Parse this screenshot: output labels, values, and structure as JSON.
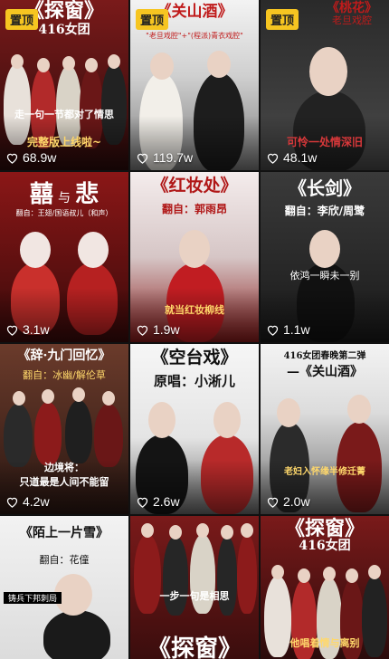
{
  "pin_label": "置顶",
  "tiles": [
    {
      "title": "《探窗》",
      "subtitle": "416女团",
      "caption1": "走一句一节都对了情思",
      "caption2": "完整版上线啦~",
      "likes": "68.9w",
      "pinned": true
    },
    {
      "title": "《关山酒》",
      "subtitle": "\"老旦戏腔\"+\"(程派)青衣戏腔\"",
      "likes": "119.7w",
      "pinned": true
    },
    {
      "title": "《桃花》",
      "subtitle": "老旦戏腔",
      "caption1": "可怜一处情深旧",
      "likes": "48.1w",
      "pinned": true
    },
    {
      "title": "囍",
      "title2": "与",
      "title3": "悲",
      "subtitle": "翻自：王翅/国语叔儿（和声）",
      "likes": "3.1w"
    },
    {
      "title": "《红妆处》",
      "subtitle": "翻自：郭雨昂",
      "caption1": "就当红妆柳线",
      "likes": "1.9w"
    },
    {
      "title": "《长剑》",
      "subtitle": "翻自：李欣/周鹭",
      "caption1": "依鸿一瞬未一别",
      "likes": "1.1w"
    },
    {
      "title": "《辞·九门回忆》",
      "subtitle": "翻自：冰幽/解伦草",
      "caption1": "边境将：",
      "caption2": "只道最是人间不能留",
      "likes": "4.2w"
    },
    {
      "title": "《空台戏》",
      "subtitle": "原唱：小淅儿",
      "likes": "2.6w"
    },
    {
      "title": "416女团春晚第二弹",
      "subtitle": "—《关山酒》",
      "caption1": "老妇入怀缘半修迁菁",
      "likes": "2.0w"
    },
    {
      "title": "《陌上一片雪》",
      "subtitle": "翻自：花僮",
      "caption1": "铸兵下邦刺局"
    },
    {
      "title": "一步一句是相思",
      "subtitle": "《探窗》"
    },
    {
      "title": "《探窗》",
      "subtitle": "416女团",
      "caption1": "他唱着情与离别"
    }
  ]
}
